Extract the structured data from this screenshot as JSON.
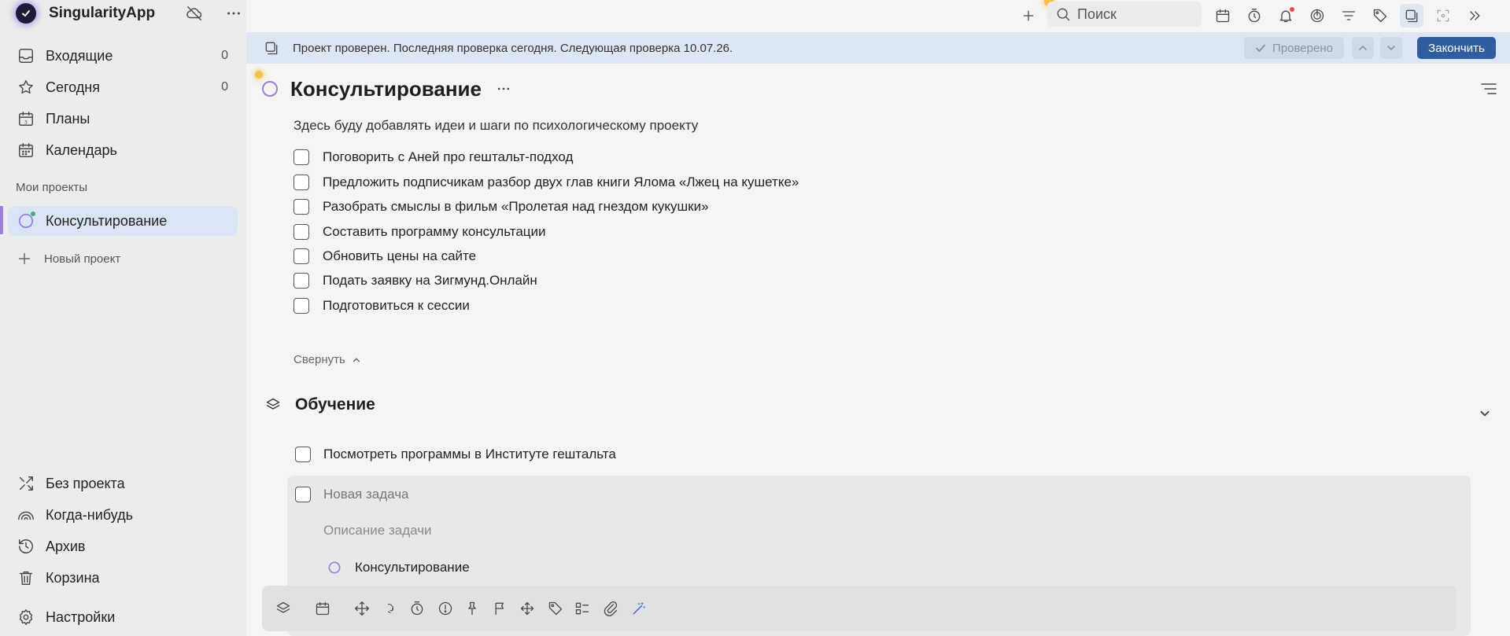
{
  "app": {
    "name": "SingularityApp"
  },
  "sidebar": {
    "top_items": [
      {
        "label": "Входящие",
        "count": "0",
        "icon": "inbox-icon"
      },
      {
        "label": "Сегодня",
        "count": "0",
        "icon": "star-icon"
      },
      {
        "label": "Планы",
        "icon": "plans-calendar-icon"
      },
      {
        "label": "Календарь",
        "icon": "calendar-icon"
      }
    ],
    "projects_title": "Мои проекты",
    "projects": [
      {
        "label": "Консультирование",
        "active": true
      }
    ],
    "new_project": "Новый проект",
    "bottom_items": [
      {
        "label": "Без проекта",
        "icon": "no-project-icon"
      },
      {
        "label": "Когда-нибудь",
        "icon": "rainbow-icon"
      },
      {
        "label": "Архив",
        "icon": "history-icon"
      },
      {
        "label": "Корзина",
        "icon": "trash-icon"
      },
      {
        "label": "Настройки",
        "icon": "gear-icon"
      }
    ]
  },
  "topbar": {
    "search_placeholder": "Поиск"
  },
  "banner": {
    "text": "Проект проверен. Последняя проверка сегодня. Следующая проверка 10.07.26.",
    "checked_label": "Проверено",
    "finish_label": "Закончить"
  },
  "project": {
    "title": "Консультирование",
    "description": "Здесь буду добавлять идеи и шаги по психологическому проекту",
    "tasks": [
      "Поговорить с Аней про гештальт-подход",
      "Предложить подписчикам разбор двух глав книги Ялома «Лжец на кушетке»",
      "Разобрать смыслы в фильм «Пролетая над гнездом кукушки»",
      "Составить программу консультации",
      "Обновить цены на сайте",
      "Подать заявку на Зигмунд.Онлайн",
      "Подготовиться к сессии"
    ],
    "collapse_label": "Свернуть"
  },
  "section": {
    "title": "Обучение",
    "tasks": [
      "Посмотреть программы в Институте гештальта"
    ]
  },
  "new_task": {
    "title_placeholder": "Новая задача",
    "description_placeholder": "Описание задачи",
    "project": "Консультирование"
  },
  "colors": {
    "accent": "#2f5d9e",
    "project": "#9b7fd9",
    "banner": "#dde6f3"
  }
}
